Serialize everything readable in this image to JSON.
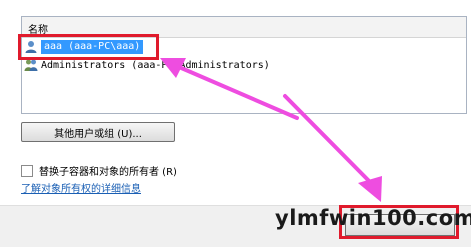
{
  "permissions_dialog": {
    "column_header": "名称",
    "rows": [
      {
        "label": "aaa (aaa-PC\\aaa)",
        "icon": "user-icon",
        "selected": true
      },
      {
        "label": "Administrators (aaa-PC\\Administrators)",
        "icon": "group-icon",
        "selected": false
      }
    ],
    "other_users_button": "其他用户或组 (U)...",
    "replace_owner_checkbox": "替换子容器和对象的所有者 (R)",
    "replace_owner_checked": false,
    "learn_more_link": "了解对象所有权的详细信息"
  },
  "annotations": {
    "highlight_color": "#e01a2c",
    "arrow_color": "#ee4de0"
  },
  "watermark": {
    "text": "ylmfwin100.com"
  }
}
